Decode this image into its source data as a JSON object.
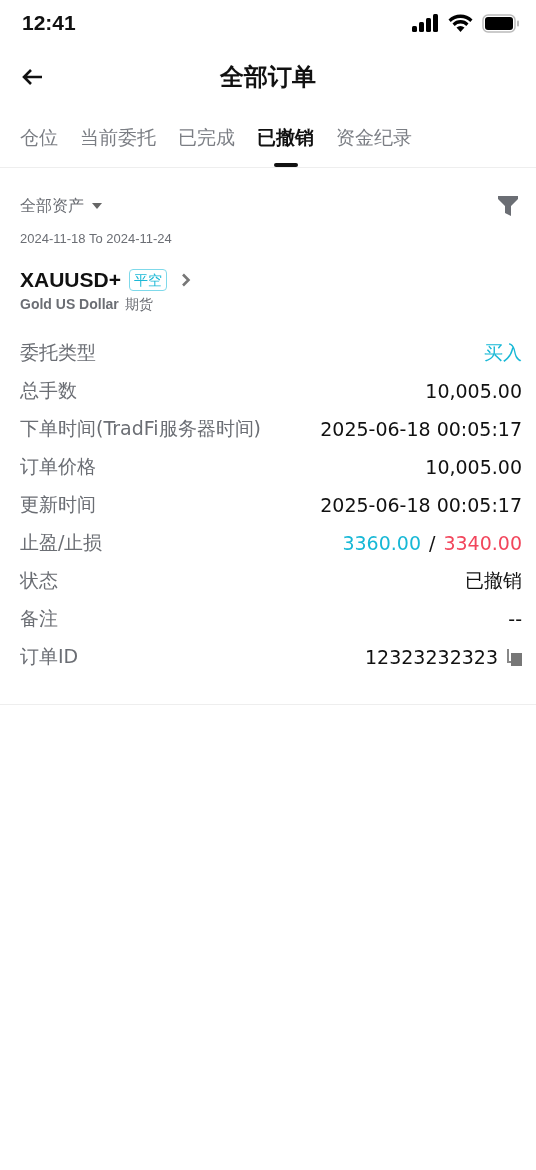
{
  "status_bar": {
    "time": "12:41"
  },
  "header": {
    "title": "全部订单"
  },
  "tabs": [
    {
      "label": "仓位",
      "selected": false
    },
    {
      "label": "当前委托",
      "selected": false
    },
    {
      "label": "已完成",
      "selected": false
    },
    {
      "label": "已撤销",
      "selected": true
    },
    {
      "label": "资金纪录",
      "selected": false
    }
  ],
  "filter": {
    "asset": "全部资产",
    "date_range": "2024-11-18 To 2024-11-24"
  },
  "order": {
    "symbol": "XAUUSD+",
    "tag": "平空",
    "name": "Gold US Dollar",
    "type": "期货",
    "fields": [
      {
        "kind": "accent",
        "label": "委托类型",
        "value": "买入"
      },
      {
        "kind": "plain",
        "label": "总手数",
        "value": "10,005.00"
      },
      {
        "kind": "plain",
        "label": "下单时间(TradFi服务器时间)",
        "value": "2025-06-18 00:05:17"
      },
      {
        "kind": "plain",
        "label": "订单价格",
        "value": "10,005.00"
      },
      {
        "kind": "plain",
        "label": "更新时间",
        "value": "2025-06-18 00:05:17"
      },
      {
        "kind": "tpsl",
        "label": "止盈/止损",
        "take_profit": "3360.00",
        "separator": "/",
        "stop_loss": "3340.00"
      },
      {
        "kind": "plain",
        "label": "状态",
        "value": "已撤销"
      },
      {
        "kind": "plain",
        "label": "备注",
        "value": "--"
      },
      {
        "kind": "copy",
        "label": "订单ID",
        "value": "12323232323"
      }
    ]
  }
}
